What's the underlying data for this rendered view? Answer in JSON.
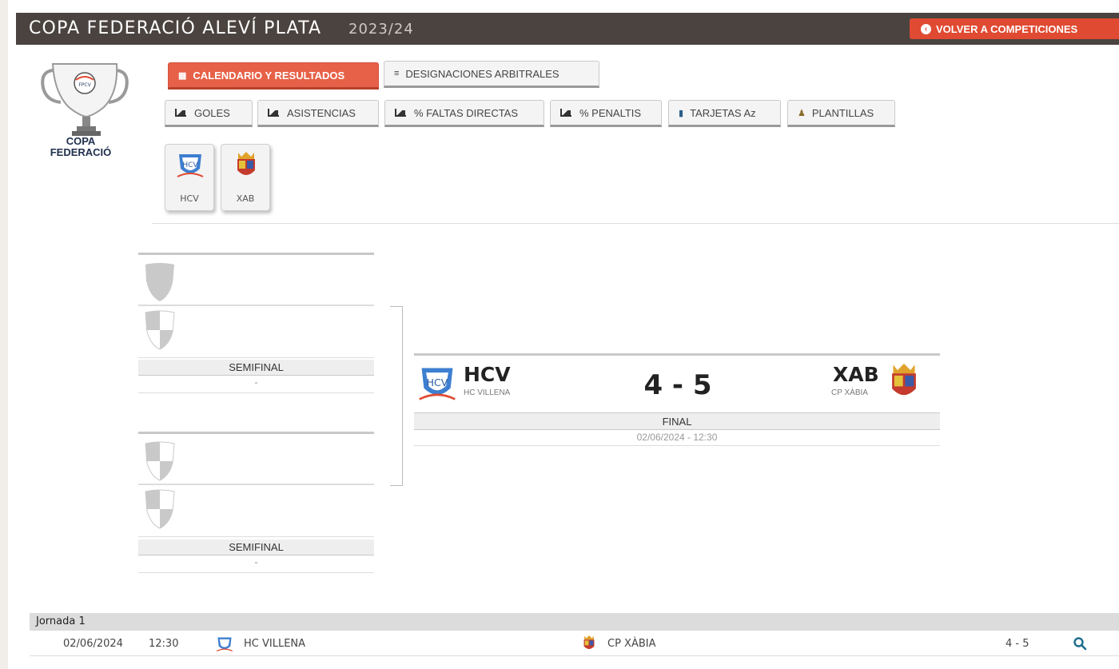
{
  "header": {
    "title": "COPA FEDERACIÓ ALEVÍ PLATA",
    "season": "2023/24",
    "back_button": "VOLVER A COMPETICIONES"
  },
  "logo": {
    "badge": "FPCV",
    "line1": "COPA",
    "line2": "FEDERACIÓ"
  },
  "tabs_main": [
    {
      "label": "CALENDARIO Y RESULTADOS",
      "icon": "calendar-icon",
      "active": true
    },
    {
      "label": "DESIGNACIONES ARBITRALES",
      "icon": "list-icon",
      "active": false
    }
  ],
  "tabs_stats": [
    {
      "label": "GOLES",
      "icon": "chart-icon"
    },
    {
      "label": "ASISTENCIAS",
      "icon": "chart-icon"
    },
    {
      "label": "% FALTAS DIRECTAS",
      "icon": "chart-icon"
    },
    {
      "label": "% PENALTIS",
      "icon": "chart-icon"
    },
    {
      "label": "TARJETAS Az",
      "icon": "card-icon"
    },
    {
      "label": "PLANTILLAS",
      "icon": "person-icon"
    }
  ],
  "team_filters": [
    {
      "abbr": "HCV"
    },
    {
      "abbr": "XAB"
    }
  ],
  "bracket": {
    "semifinal_1": {
      "label": "SEMIFINAL",
      "sub": "-"
    },
    "semifinal_2": {
      "label": "SEMIFINAL",
      "sub": "-"
    },
    "final": {
      "home_abbr": "HCV",
      "home_name": "HC VILLENA",
      "away_abbr": "XAB",
      "away_name": "CP XÀBIA",
      "score": "4 - 5",
      "label": "FINAL",
      "datetime": "02/06/2024 - 12:30"
    }
  },
  "schedule": {
    "jornada": "Jornada 1",
    "matches": [
      {
        "date": "02/06/2024",
        "time": "12:30",
        "home": "HC VILLENA",
        "away": "CP XÀBIA",
        "score": "4 - 5"
      }
    ]
  },
  "colors": {
    "accent": "#e76148",
    "header_bg": "#4a4340",
    "search_icon": "#1f6d8c"
  }
}
